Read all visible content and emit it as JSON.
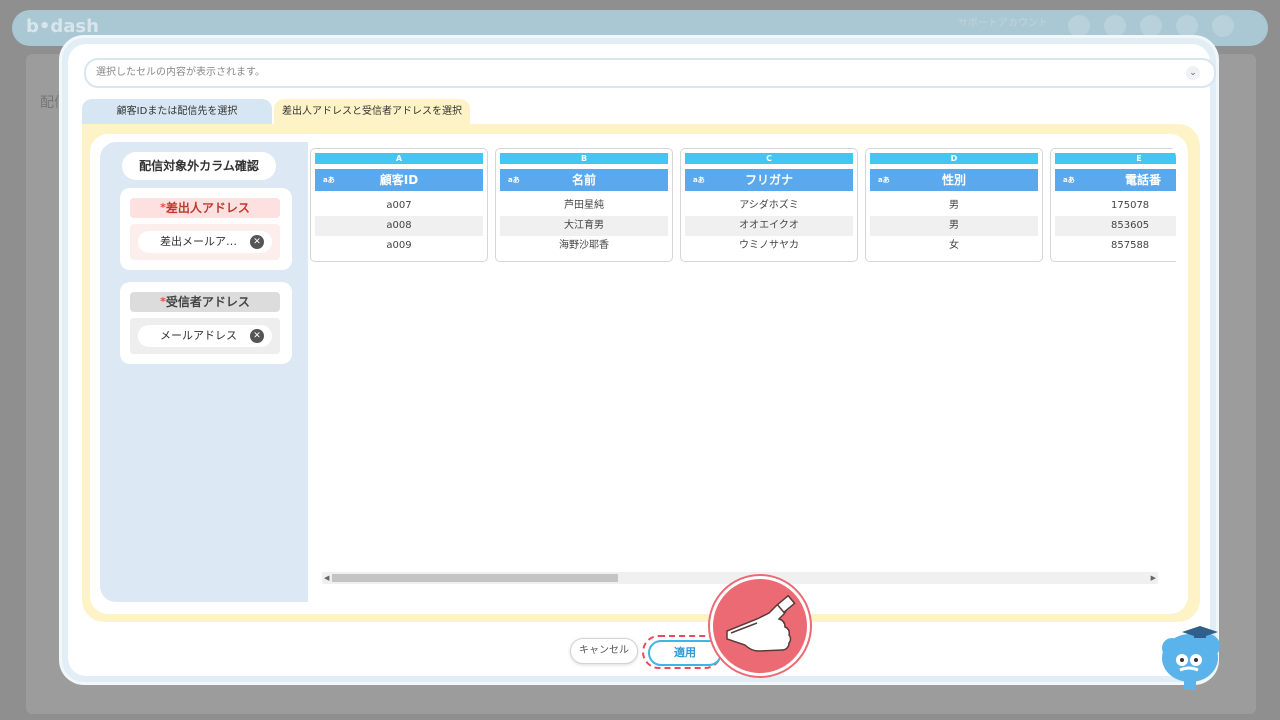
{
  "background": {
    "logo": "b•dash",
    "account_label": "サポートアカウント",
    "page_label": "配信"
  },
  "modal": {
    "selector_placeholder": "選択したセルの内容が表示されます。",
    "tabs": [
      {
        "label": "顧客IDまたは配信先を選択"
      },
      {
        "label": "差出人アドレスと受信者アドレスを選択"
      }
    ],
    "left": {
      "check_button": "配信対象外カラム確認",
      "required_mark": "*",
      "sender": {
        "title": "差出人アドレス",
        "chip": "差出メールア…",
        "remove": "✕"
      },
      "receiver": {
        "title": "受信者アドレス",
        "chip": "メールアドレス",
        "remove": "✕"
      }
    },
    "columns": [
      {
        "letter": "A",
        "type": "aあ",
        "name": "顧客ID",
        "cells": [
          "a007",
          "a008",
          "a009"
        ]
      },
      {
        "letter": "B",
        "type": "aあ",
        "name": "名前",
        "cells": [
          "芦田星純",
          "大江育男",
          "海野沙耶香"
        ]
      },
      {
        "letter": "C",
        "type": "aあ",
        "name": "フリガナ",
        "cells": [
          "アシダホズミ",
          "オオエイクオ",
          "ウミノサヤカ"
        ]
      },
      {
        "letter": "D",
        "type": "aあ",
        "name": "性別",
        "cells": [
          "男",
          "男",
          "女"
        ]
      },
      {
        "letter": "E",
        "type": "aあ",
        "name": "電話番",
        "cells": [
          "175078",
          "853605",
          "857588"
        ]
      }
    ],
    "scroll": {
      "left": "◀",
      "right": "▶"
    },
    "buttons": {
      "cancel": "キャンセル",
      "apply": "適用"
    }
  }
}
